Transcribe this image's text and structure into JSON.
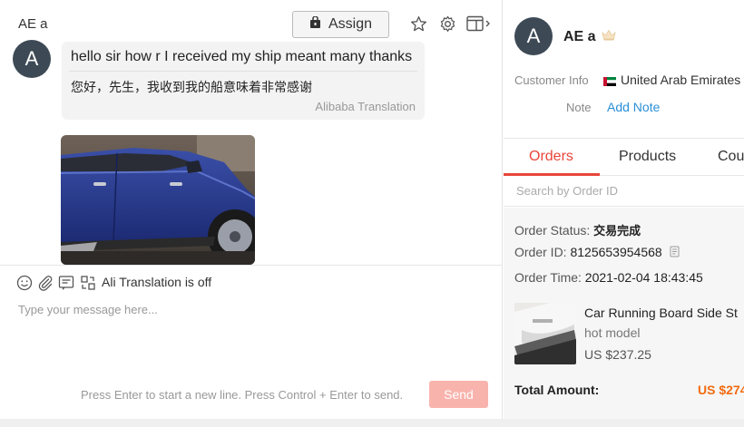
{
  "chat": {
    "contact_name": "AE a",
    "assign_label": "Assign",
    "avatar_letter": "A",
    "message": {
      "text": "hello sir how r I received my ship meant many thanks",
      "translation": "您好，先生，我收到我的船意味着非常感谢",
      "translation_source": "Alibaba Translation"
    },
    "toolbar": {
      "translation_status": "Ali Translation is off"
    },
    "input": {
      "placeholder": "Type your message here..."
    },
    "hint": "Press Enter to start a new line. Press Control + Enter to send.",
    "send_label": "Send",
    "icons": [
      "lock-bag-icon",
      "star-icon",
      "gear-icon",
      "panel-toggle-icon",
      "emoji-icon",
      "paperclip-icon",
      "quick-reply-icon",
      "translate-icon"
    ]
  },
  "customer": {
    "avatar_letter": "A",
    "name": "AE a",
    "badge_icon": "crown-icon",
    "info_label": "Customer Info",
    "country": "United Arab Emirates",
    "note_label": "Note",
    "add_note_label": "Add Note"
  },
  "tabs": [
    {
      "label": "Orders",
      "active": true
    },
    {
      "label": "Products",
      "active": false
    },
    {
      "label": "Cou",
      "active": false
    }
  ],
  "order_search": {
    "placeholder": "Search by Order ID"
  },
  "order": {
    "status_label": "Order Status:",
    "status_value": "交易完成",
    "id_label": "Order ID:",
    "id_value": "8125653954568",
    "time_label": "Order Time:",
    "time_value": "2021-02-04 18:43:45",
    "product_title": "Car Running Board Side St",
    "product_sub": "hot model",
    "product_price": "US $237.25",
    "total_label": "Total Amount:",
    "total_value": "US $274"
  },
  "colors": {
    "accent_red": "#e8463a",
    "link_blue": "#2a8fd6",
    "total_orange": "#f26b0f",
    "send_disabled": "#f9b3ad",
    "avatar_bg": "#3d4a56"
  }
}
